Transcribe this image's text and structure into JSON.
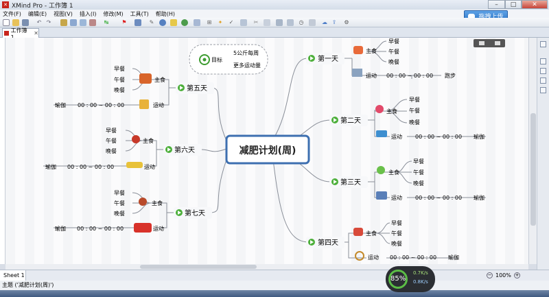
{
  "window": {
    "title": "XMind Pro - 工作簿 1",
    "min": "–",
    "max": "□",
    "close": "✕"
  },
  "menu": [
    "文件(F)",
    "编辑(E)",
    "视图(V)",
    "插入(I)",
    "修改(M)",
    "工具(T)",
    "帮助(H)"
  ],
  "upload_label": "拖拽上传",
  "tab": {
    "label": "工作簿 1",
    "close": "✕"
  },
  "central": "减肥计划(周)",
  "goal": {
    "label": "目标",
    "items": [
      "5公斤每周",
      "更多运动量"
    ]
  },
  "meals": [
    "早餐",
    "午餐",
    "晚餐"
  ],
  "staple": "主食",
  "exercise": "运动",
  "time_range": "00 : 00 ~ 00 : 00",
  "days": [
    {
      "name": "第一天",
      "activity": "跑步"
    },
    {
      "name": "第二天",
      "activity": "瑜伽"
    },
    {
      "name": "第三天",
      "activity": "瑜伽"
    },
    {
      "name": "第四天",
      "activity": "瑜伽"
    },
    {
      "name": "第五天",
      "activity": "瑜伽"
    },
    {
      "name": "第六天",
      "activity": "瑜伽"
    },
    {
      "name": "第七天",
      "activity": "瑜伽"
    }
  ],
  "sheet": "Sheet 1",
  "zoom": "100%",
  "status": "主题 ('减肥计划(周)')",
  "network": {
    "percent": "85%",
    "up": "0.7K/s",
    "down": "0.8K/s"
  },
  "colors": {
    "accent": "#3d6fb0",
    "branch": "#8a8f99",
    "day_icon": "#4caf3a",
    "goal_icon": "#3d9c30"
  }
}
